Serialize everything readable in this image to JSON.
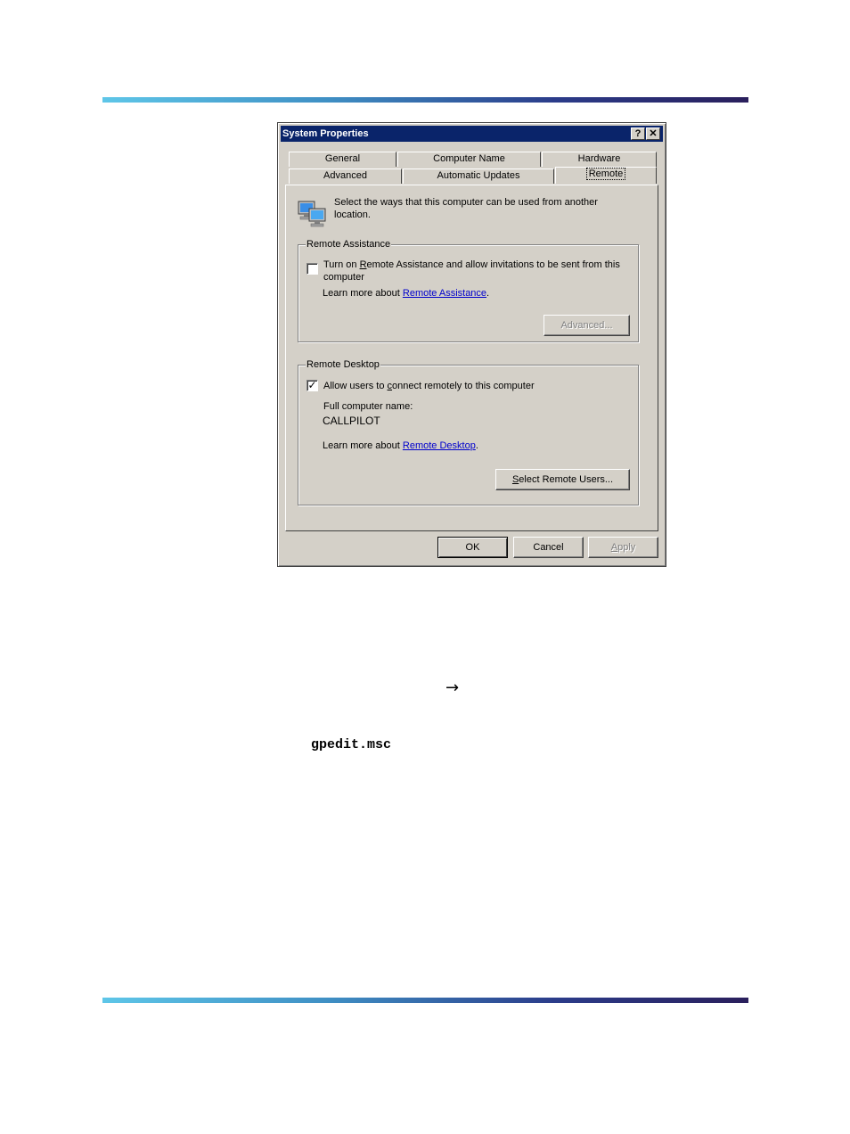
{
  "dialog": {
    "title": "System Properties",
    "help_glyph": "?",
    "close_glyph": "✕",
    "tabs_row1": [
      "General",
      "Computer Name",
      "Hardware"
    ],
    "tabs_row2": [
      "Advanced",
      "Automatic Updates",
      "Remote"
    ],
    "active_tab": "Remote",
    "intro_line1": "Select the ways that this computer can be used from another",
    "intro_line2": "location.",
    "remote_assistance": {
      "group_label": "Remote Assistance",
      "checkbox_pre": "Turn on ",
      "checkbox_accel": "R",
      "checkbox_post": "emote Assistance and allow invitations to be sent from this",
      "checkbox_line2": "computer",
      "checked": false,
      "learn_prefix": "Learn more about ",
      "learn_link": "Remote Assistance",
      "learn_suffix": ".",
      "advanced_button": "Advanced..."
    },
    "remote_desktop": {
      "group_label": "Remote Desktop",
      "checkbox_pre": "Allow users to ",
      "checkbox_accel": "c",
      "checkbox_post": "onnect remotely to this computer",
      "checked": true,
      "check_glyph": "✓",
      "full_name_label": "Full computer name:",
      "full_name_value": "CALLPILOT",
      "learn_prefix": "Learn more about ",
      "learn_link": "Remote Desktop",
      "learn_suffix": ".",
      "select_users_accel": "S",
      "select_users_rest": "elect Remote Users..."
    },
    "buttons": {
      "ok": "OK",
      "cancel": "Cancel",
      "apply_accel": "A",
      "apply_rest": "pply"
    }
  },
  "doc": {
    "arrow": "→",
    "command": "gpedit.msc"
  },
  "colors": {
    "titlebar": "#0a246a",
    "dialog_bg": "#d4d0c8",
    "link": "#0000cc"
  }
}
